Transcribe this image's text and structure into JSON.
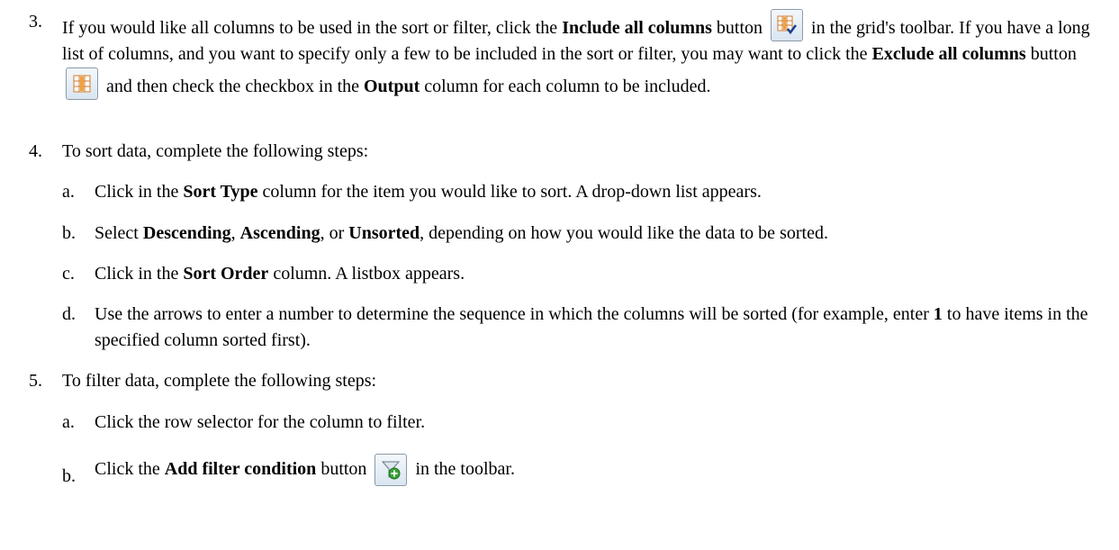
{
  "step3": {
    "num": "3.",
    "t1": "If you would like all columns to be used in the sort or filter, click the ",
    "b1": "Include all columns",
    "t2": " button",
    "t3": " in the grid's toolbar. If you have a long list of columns, and you want to specify only a few to be included in the sort or filter, you may want to click the ",
    "b2": "Exclude all columns",
    "t4": " button",
    "t5": " and then check the checkbox in the ",
    "b3": "Output",
    "t6": " column for each column to be included."
  },
  "step4": {
    "num": "4.",
    "text": "To sort data, complete the following steps:",
    "subs": [
      {
        "letter": "a.",
        "t1": "Click in the ",
        "b1": "Sort Type",
        "t2": " column for the item you would like to sort. A drop-down list appears."
      },
      {
        "letter": "b.",
        "t1": "Select ",
        "b1": "Descending",
        "t2": ", ",
        "b2": "Ascending",
        "t3": ", or ",
        "b3": "Unsorted",
        "t4": ", depending on how you would like the data to be sorted."
      },
      {
        "letter": "c.",
        "t1": "Click in the ",
        "b1": "Sort Order",
        "t2": " column. A listbox appears."
      },
      {
        "letter": "d.",
        "t1": "Use the arrows to enter a number to determine the sequence in which the columns will be sorted (for example, enter ",
        "b1": "1",
        "t2": " to have items in the specified column sorted first)."
      }
    ]
  },
  "step5": {
    "num": "5.",
    "text": "To filter data, complete the following steps:",
    "subs": [
      {
        "letter": "a.",
        "t1": "Click the row selector for the column to filter."
      },
      {
        "letter": "b.",
        "t1": "Click the ",
        "b1": "Add filter condition",
        "t2": " button",
        "t3": " in the toolbar."
      }
    ]
  },
  "icons": {
    "include_all_columns": "include-all-columns-icon",
    "exclude_all_columns": "exclude-all-columns-icon",
    "add_filter_condition": "add-filter-condition-icon"
  }
}
